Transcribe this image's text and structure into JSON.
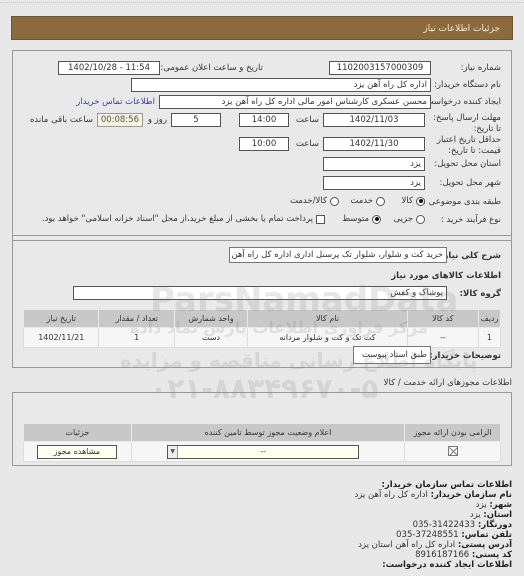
{
  "header": {
    "title": "جزئیات اطلاعات نیاز"
  },
  "form": {
    "need_number_label": "شماره نیاز:",
    "need_number": "1102003157000309",
    "announce_label": "تاریخ و ساعت اعلان عمومی:",
    "announce_value": "1402/10/28 - 11:54",
    "buyer_org_label": "نام دستگاه خریدار:",
    "buyer_org": "اداره کل راه آهن یزد",
    "creator_label": "ایجاد کننده درخواست:",
    "creator": "محسن عسکری کارشناس امور مالی اداره کل راه آهن یزد",
    "buyer_contact_link": "اطلاعات تماس خریدار",
    "deadline_label": "مهلت ارسال پاسخ: تا تاریخ:",
    "deadline_date": "1402/11/03",
    "time_label": "ساعت",
    "deadline_time": "14:00",
    "days_value": "5",
    "days_label": "روز و",
    "remaining_time": "00:08:56",
    "remaining_label": "ساعت باقی مانده",
    "validity_label": "حداقل تاریخ اعتبار قیمت: تا تاریخ:",
    "validity_date": "1402/11/30",
    "validity_time": "10:00",
    "province_label": "استان محل تحویل:",
    "province": "یزد",
    "city_label": "شهر محل تحویل:",
    "city": "یزد",
    "category_label": "طبقه بندی موضوعی :",
    "category_options": [
      {
        "label": "کالا",
        "selected": true
      },
      {
        "label": "خدمت",
        "selected": false
      },
      {
        "label": "کالا/خدمت",
        "selected": false
      }
    ],
    "process_label": "نوع فرآیند خرید :",
    "process_options": [
      {
        "label": "جزیی",
        "selected": false
      },
      {
        "label": "متوسط",
        "selected": true
      }
    ],
    "treasury_checkbox_label": "پرداخت تمام یا بخشی از مبلغ خرید،از محل \"اسناد خزانه اسلامی\" خواهد بود."
  },
  "summary": {
    "desc_label": "شرح کلی نیاز:",
    "desc": "خرید کت و شلوار، شلوار تک پرسنل اداری اداره کل راه آهن یزد",
    "goods_info_title": "اطلاعات کالاهای مورد نیاز",
    "goods_group_label": "گروه کالا:",
    "goods_group": "پوشاک و کفش",
    "table": {
      "headers": [
        "ردیف",
        "کد کالا",
        "نام کالا",
        "واحد شمارش",
        "تعداد / مقدار",
        "تاریخ نیاز"
      ],
      "rows": [
        [
          "1",
          "--",
          "کت تک و کت و شلوار مردانه",
          "دست",
          "1",
          "1402/11/21"
        ]
      ]
    },
    "buyer_notes_label": "توضیحات خریدار:",
    "buyer_notes": "طبق اسناد پیوست"
  },
  "permits": {
    "title": "اطلاعات مجوزهای ارائه خدمت / کالا",
    "headers": [
      "الزامی بودن ارائه مجوز",
      "اعلام وضعیت مجوز توسط تامین کننده",
      "جزئیات"
    ],
    "select_value": "--",
    "view_button": "مشاهده مجوز"
  },
  "contact": {
    "title": "اطلاعات تماس سازمان خریدار:",
    "org_label": "نام سازمان خریدار:",
    "org": "اداره کل راه آهن یزد",
    "city_label": "شهر:",
    "city": "یزد",
    "province_label": "استان:",
    "province": "یزد",
    "fax_label": "دورنگار:",
    "fax": "035-31422433",
    "phone_label": "تلفن تماس:",
    "phone": "035-37248551",
    "address_label": "آدرس پستی:",
    "address": "اداره کل راه آهن استان یزد",
    "postal_label": "کد پستی:",
    "postal": "8916187166",
    "creator_title": "اطلاعات ایجاد کننده درخواست:"
  },
  "watermark": {
    "brand": "ParsNamadData",
    "line1": "مرکز فراوری اطلاعات پارس نماد داده",
    "line2": "پایگاه اطلاع رسانی مناقصه و مزایده",
    "phone": "۰۲۱-۸۸۳۴۹۶۷۰-۵"
  }
}
